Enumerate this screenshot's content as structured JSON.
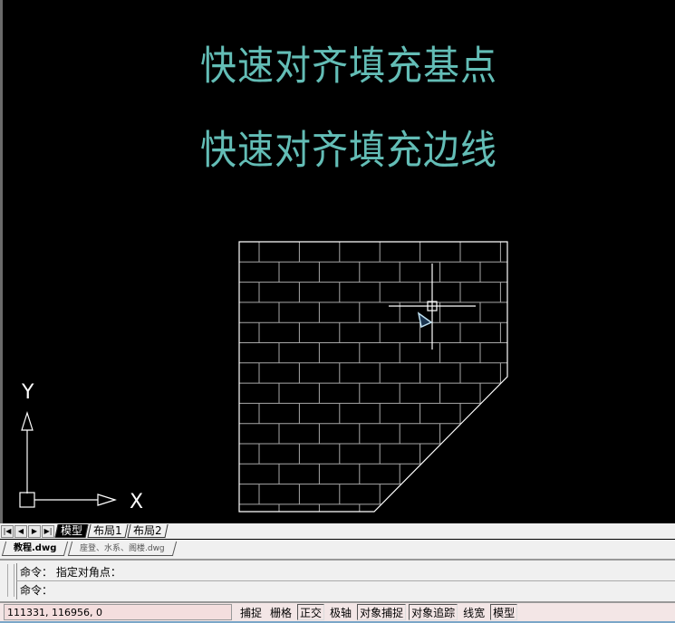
{
  "canvas": {
    "text_lines": [
      "快速对齐填充基点",
      "快速对齐填充边线"
    ],
    "text_color": "#63bdb6",
    "ucs_x_label": "X",
    "ucs_y_label": "Y",
    "hatch_pattern": "brick"
  },
  "layout_tabs": [
    {
      "label": "模型",
      "active": true
    },
    {
      "label": "布局1"
    },
    {
      "label": "布局2"
    }
  ],
  "file_tabs": [
    {
      "label": "教程.dwg",
      "active": true
    },
    {
      "label": "座登、水系、阁楼.dwg"
    }
  ],
  "command": {
    "lines": [
      "命令： 指定对角点：",
      "命令："
    ]
  },
  "status": {
    "coords": "111331, 116956, 0",
    "buttons": [
      {
        "label": "捕捉",
        "on": false
      },
      {
        "label": "栅格",
        "on": false
      },
      {
        "label": "正交",
        "on": true
      },
      {
        "label": "极轴",
        "on": false
      },
      {
        "label": "对象捕捉",
        "on": true
      },
      {
        "label": "对象追踪",
        "on": true
      },
      {
        "label": "线宽",
        "on": false
      },
      {
        "label": "模型",
        "on": true
      }
    ]
  }
}
